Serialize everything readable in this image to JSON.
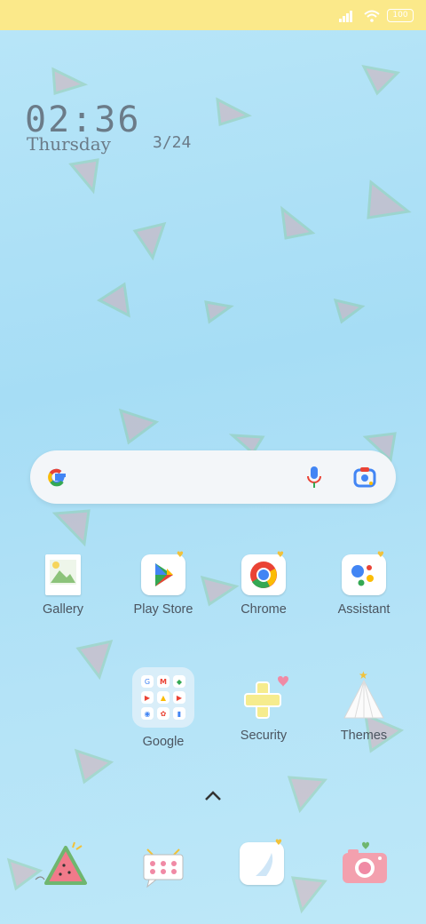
{
  "status_bar": {
    "battery": "100"
  },
  "clock": {
    "time": "02:36",
    "day": "Thursday",
    "date": "3/24"
  },
  "apps": [
    {
      "label": "Gallery"
    },
    {
      "label": "Play Store"
    },
    {
      "label": "Chrome"
    },
    {
      "label": "Assistant"
    },
    {
      "label": "Google"
    },
    {
      "label": "Security"
    },
    {
      "label": "Themes"
    }
  ],
  "colors": {
    "status_bar_bg": "#fbe98a",
    "wallpaper": "#a6ddf5",
    "label_text": "#4b5560"
  },
  "icons": {
    "search_logo": "google-g-icon",
    "voice": "microphone-icon",
    "camera": "google-lens-icon",
    "app_drawer": "chevron-up-icon",
    "dock": [
      "watermelon-icon",
      "chat-bubble-icon",
      "notes-icon",
      "camera-icon"
    ]
  }
}
